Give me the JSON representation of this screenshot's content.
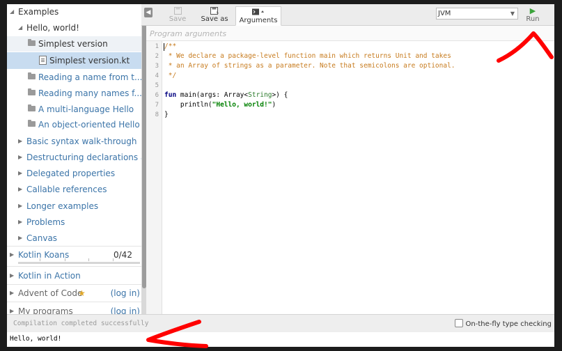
{
  "sidebar": {
    "root_label": "Examples",
    "hello_folder": "Hello, world!",
    "simplest_folder": "Simplest version",
    "simplest_file": "Simplest version.kt",
    "examples": [
      "Reading a name from t...",
      "Reading many names f...",
      "A multi-language Hello",
      "An object-oriented Hello"
    ],
    "sections": [
      "Basic syntax walk-through",
      "Destructuring declarations a",
      "Delegated properties",
      "Callable references",
      "Longer examples",
      "Problems",
      "Canvas"
    ],
    "koans": {
      "label": "Kotlin Koans",
      "progress": "0/42",
      "progress_fraction": 0
    },
    "in_action": "Kotlin in Action",
    "advent": {
      "label": "Advent of Code",
      "login": "(log in)"
    },
    "my_programs": {
      "label": "My programs",
      "login": "(log in)"
    }
  },
  "toolbar": {
    "save_label": "Save",
    "save_as_label": "Save as",
    "arguments_label": "Arguments",
    "target": "JVM",
    "run_label": "Run"
  },
  "args": {
    "placeholder": "Program arguments"
  },
  "editor": {
    "line_numbers": [
      "1",
      "2",
      "3",
      "4",
      "5",
      "6",
      "7",
      "8"
    ],
    "comment_open": "/**",
    "comment_line2": " * We declare a package-level function main which returns Unit and takes",
    "comment_line3": " * an Array of strings as a parameter. Note that semicolons are optional.",
    "comment_close": " */",
    "fun_kw": "fun",
    "main_sig_a": " main(args: Array<",
    "main_type": "String",
    "main_sig_b": ">) {",
    "println_a": "    println(",
    "println_str": "\"Hello, world!\"",
    "println_b": ")",
    "close_brace": "}"
  },
  "status": {
    "message": "Compilation completed successfully",
    "onfly_label": "On-the-fly type checking"
  },
  "console": {
    "output": "Hello, world!"
  },
  "colors": {
    "link": "#3b74a8",
    "selected_row": "#c8dcf0",
    "run_green": "#3aa33a",
    "annotation_red": "#ff0000",
    "comment": "#c77b1e",
    "keyword": "#000080",
    "string": "#008000"
  }
}
